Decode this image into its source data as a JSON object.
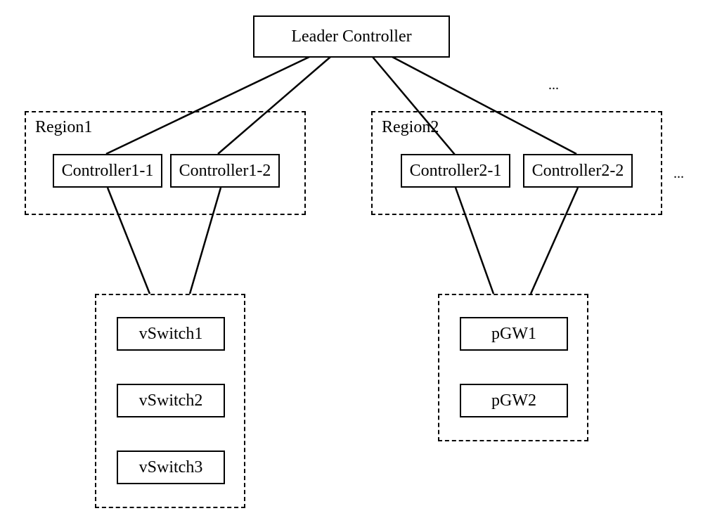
{
  "leader": {
    "label": "Leader Controller"
  },
  "regions": [
    {
      "label": "Region1",
      "controllers": [
        {
          "label": "Controller1-1"
        },
        {
          "label": "Controller1-2"
        }
      ]
    },
    {
      "label": "Region2",
      "controllers": [
        {
          "label": "Controller2-1"
        },
        {
          "label": "Controller2-2"
        }
      ]
    }
  ],
  "device_groups": [
    {
      "devices": [
        {
          "label": "vSwitch1"
        },
        {
          "label": "vSwitch2"
        },
        {
          "label": "vSwitch3"
        }
      ]
    },
    {
      "devices": [
        {
          "label": "pGW1"
        },
        {
          "label": "pGW2"
        }
      ]
    }
  ],
  "ellipsis_top": "...",
  "ellipsis_right": "..."
}
